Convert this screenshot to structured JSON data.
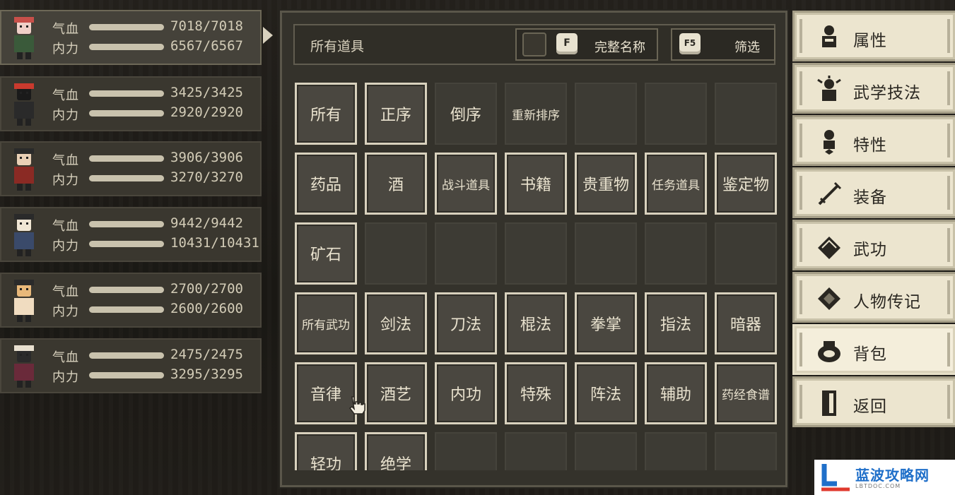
{
  "party": [
    {
      "hp_label": "气血",
      "mp_label": "内力",
      "hp": "7018/7018",
      "mp": "6567/6567",
      "hp_fill": 1.0,
      "mp_fill": 1.0,
      "selected": true
    },
    {
      "hp_label": "气血",
      "mp_label": "内力",
      "hp": "3425/3425",
      "mp": "2920/2920",
      "hp_fill": 1.0,
      "mp_fill": 1.0
    },
    {
      "hp_label": "气血",
      "mp_label": "内力",
      "hp": "3906/3906",
      "mp": "3270/3270",
      "hp_fill": 1.0,
      "mp_fill": 1.0
    },
    {
      "hp_label": "气血",
      "mp_label": "内力",
      "hp": "9442/9442",
      "mp": "10431/10431",
      "hp_fill": 1.0,
      "mp_fill": 1.0
    },
    {
      "hp_label": "气血",
      "mp_label": "内力",
      "hp": "2700/2700",
      "mp": "2600/2600",
      "hp_fill": 1.0,
      "mp_fill": 1.0
    },
    {
      "hp_label": "气血",
      "mp_label": "内力",
      "hp": "2475/2475",
      "mp": "3295/3295",
      "hp_fill": 1.0,
      "mp_fill": 1.0
    }
  ],
  "inventory": {
    "title": "所有道具",
    "fullname_key": "F",
    "fullname_label": "完整名称",
    "filter_key": "F5",
    "filter_label": "筛选",
    "rows": [
      [
        "所有",
        "正序",
        "倒序",
        "重新排序",
        "",
        "",
        ""
      ],
      [
        "药品",
        "酒",
        "战斗道具",
        "书籍",
        "贵重物",
        "任务道具",
        "鉴定物"
      ],
      [
        "矿石",
        "",
        "",
        "",
        "",
        "",
        ""
      ],
      [
        "所有武功",
        "剑法",
        "刀法",
        "棍法",
        "拳掌",
        "指法",
        "暗器"
      ],
      [
        "音律",
        "酒艺",
        "内功",
        "特殊",
        "阵法",
        "辅助",
        "药经食谱"
      ],
      [
        "轻功",
        "绝学",
        "",
        "",
        "",
        "",
        ""
      ]
    ]
  },
  "menu": [
    {
      "label": "属性",
      "icon": "person-icon"
    },
    {
      "label": "武学技法",
      "icon": "skill-person-icon"
    },
    {
      "label": "特性",
      "icon": "trait-icon"
    },
    {
      "label": "装备",
      "icon": "sword-icon"
    },
    {
      "label": "武功",
      "icon": "book-icon"
    },
    {
      "label": "人物传记",
      "icon": "scroll-icon"
    },
    {
      "label": "背包",
      "icon": "bag-icon",
      "active": true
    },
    {
      "label": "返回",
      "icon": "door-icon"
    }
  ],
  "watermark": {
    "title": "蓝波攻略网",
    "subtitle": "LBTDOC.COM"
  },
  "colors": {
    "panel": "#34322b",
    "cell_border": "#d8d1bd",
    "menu_bg": "#ece5cf",
    "bar": "#c9c2ad"
  }
}
